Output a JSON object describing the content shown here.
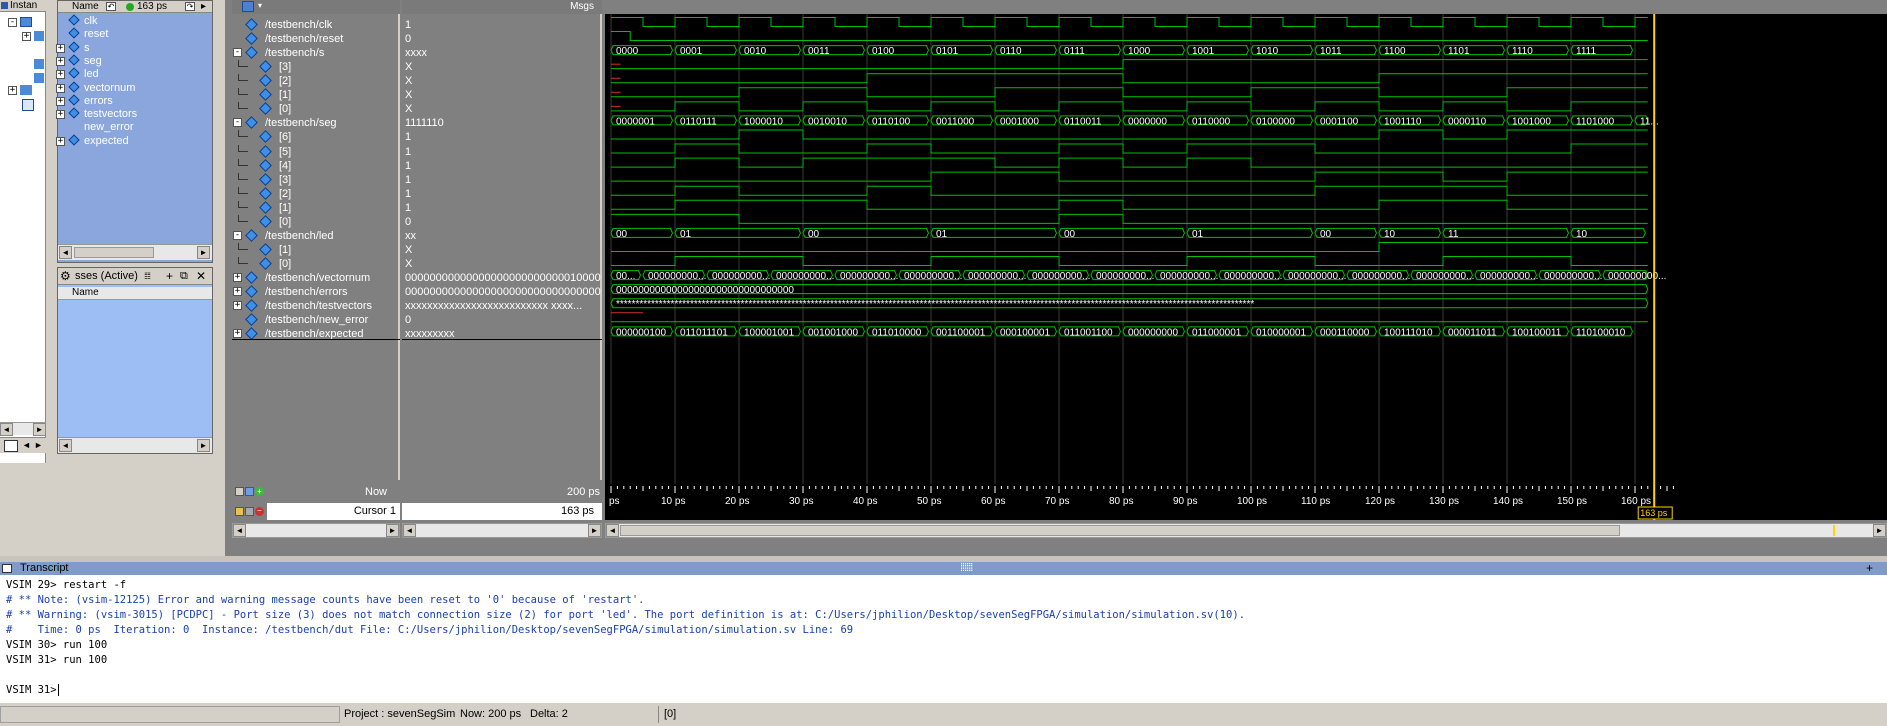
{
  "instance_panel": {
    "title": "Instan"
  },
  "objects_panel": {
    "header_name": "Name",
    "time_field": "163 ps",
    "items": [
      {
        "label": "clk",
        "expand": false
      },
      {
        "label": "reset",
        "expand": false
      },
      {
        "label": "s",
        "expand": true
      },
      {
        "label": "seg",
        "expand": true
      },
      {
        "label": "led",
        "expand": true
      },
      {
        "label": "vectornum",
        "expand": true
      },
      {
        "label": "errors",
        "expand": true
      },
      {
        "label": "testvectors",
        "expand": true
      },
      {
        "label": "new_error",
        "expand": false
      },
      {
        "label": "expected",
        "expand": true
      }
    ]
  },
  "processes_panel": {
    "title": "sses (Active)",
    "header_name": "Name"
  },
  "wave": {
    "msgs_header": "Msgs",
    "signals": [
      {
        "name": "/testbench/clk",
        "value": "1",
        "indent": 0,
        "expand": ""
      },
      {
        "name": "/testbench/reset",
        "value": "0",
        "indent": 0,
        "expand": ""
      },
      {
        "name": "/testbench/s",
        "value": "xxxx",
        "indent": 0,
        "expand": "-"
      },
      {
        "name": "[3]",
        "value": "X",
        "indent": 1,
        "expand": ""
      },
      {
        "name": "[2]",
        "value": "X",
        "indent": 1,
        "expand": ""
      },
      {
        "name": "[1]",
        "value": "X",
        "indent": 1,
        "expand": ""
      },
      {
        "name": "[0]",
        "value": "X",
        "indent": 1,
        "expand": ""
      },
      {
        "name": "/testbench/seg",
        "value": "1111110",
        "indent": 0,
        "expand": "-"
      },
      {
        "name": "[6]",
        "value": "1",
        "indent": 1,
        "expand": ""
      },
      {
        "name": "[5]",
        "value": "1",
        "indent": 1,
        "expand": ""
      },
      {
        "name": "[4]",
        "value": "1",
        "indent": 1,
        "expand": ""
      },
      {
        "name": "[3]",
        "value": "1",
        "indent": 1,
        "expand": ""
      },
      {
        "name": "[2]",
        "value": "1",
        "indent": 1,
        "expand": ""
      },
      {
        "name": "[1]",
        "value": "1",
        "indent": 1,
        "expand": ""
      },
      {
        "name": "[0]",
        "value": "0",
        "indent": 1,
        "expand": ""
      },
      {
        "name": "/testbench/led",
        "value": "xx",
        "indent": 0,
        "expand": "-"
      },
      {
        "name": "[1]",
        "value": "X",
        "indent": 1,
        "expand": ""
      },
      {
        "name": "[0]",
        "value": "X",
        "indent": 1,
        "expand": ""
      },
      {
        "name": "/testbench/vectornum",
        "value": "00000000000000000000000000010000",
        "indent": 0,
        "expand": "+"
      },
      {
        "name": "/testbench/errors",
        "value": "00000000000000000000000000000000",
        "indent": 0,
        "expand": "+"
      },
      {
        "name": "/testbench/testvectors",
        "value": "xxxxxxxxxxxxxxxxxxxxxxxxxx xxxx...",
        "indent": 0,
        "expand": "+"
      },
      {
        "name": "/testbench/new_error",
        "value": "0",
        "indent": 0,
        "expand": ""
      },
      {
        "name": "/testbench/expected",
        "value": "xxxxxxxxx",
        "indent": 0,
        "expand": "+"
      }
    ],
    "buses": {
      "s": [
        "0000",
        "0001",
        "0010",
        "0011",
        "0100",
        "0101",
        "0110",
        "0111",
        "1000",
        "1001",
        "1010",
        "1011",
        "1100",
        "1101",
        "1110",
        "1111"
      ],
      "seg": [
        "0000001",
        "0110111",
        "1000010",
        "0010010",
        "0110100",
        "0011000",
        "0001000",
        "0110011",
        "0000000",
        "0110000",
        "0100000",
        "0001100",
        "1001110",
        "0000110",
        "1001000",
        "1101000",
        "11..."
      ],
      "led": [
        {
          "t": 0,
          "v": "00"
        },
        {
          "t": 1,
          "v": "01"
        },
        {
          "t": 3,
          "v": "00"
        },
        {
          "t": 5,
          "v": "01"
        },
        {
          "t": 7,
          "v": "00"
        },
        {
          "t": 9,
          "v": "01"
        },
        {
          "t": 11,
          "v": "00"
        },
        {
          "t": 12,
          "v": "10"
        },
        {
          "t": 13,
          "v": "11"
        },
        {
          "t": 15,
          "v": "10"
        }
      ],
      "vectornum": [
        "00...",
        "000000000...",
        "000000000...",
        "000000000...",
        "000000000...",
        "000000000...",
        "000000000...",
        "000000000...",
        "000000000...",
        "000000000...",
        "000000000...",
        "000000000...",
        "000000000...",
        "000000000...",
        "000000000...",
        "000000000...",
        "000000000..."
      ],
      "errors": "00000000000000000000000000000000",
      "testvectors": "********************************************************************************************************************************************************************",
      "expected": [
        "000000100",
        "011011101",
        "100001001",
        "001001000",
        "011010000",
        "001100001",
        "000100001",
        "011001100",
        "000000000",
        "011000001",
        "010000001",
        "000110000",
        "100111010",
        "000011011",
        "100100011",
        "110100010"
      ]
    },
    "now_label": "Now",
    "now_value": "200 ps",
    "cursor_label": "Cursor 1",
    "cursor_value": "163 ps",
    "cursor_flag": "163 ps",
    "axis_ticks": [
      "ps",
      "10 ps",
      "20 ps",
      "30 ps",
      "40 ps",
      "50 ps",
      "60 ps",
      "70 ps",
      "80 ps",
      "90 ps",
      "100 ps",
      "110 ps",
      "120 ps",
      "130 ps",
      "140 ps",
      "150 ps",
      "160 ps"
    ]
  },
  "transcript": {
    "title": "Transcript",
    "lines": [
      {
        "text": "VSIM 29> restart -f",
        "cls": "cmd"
      },
      {
        "text": "# ** Note: (vsim-12125) Error and warning message counts have been reset to '0' because of 'restart'.",
        "cls": "msg"
      },
      {
        "text": "# ** Warning: (vsim-3015) [PCDPC] - Port size (3) does not match connection size (2) for port 'led'. The port definition is at: C:/Users/jphilion/Desktop/sevenSegFPGA/simulation/simulation.sv(10).",
        "cls": "msg"
      },
      {
        "text": "#    Time: 0 ps  Iteration: 0  Instance: /testbench/dut File: C:/Users/jphilion/Desktop/sevenSegFPGA/simulation/simulation.sv Line: 69",
        "cls": "msg"
      },
      {
        "text": "VSIM 30> run 100",
        "cls": "cmd"
      },
      {
        "text": "VSIM 31> run 100",
        "cls": "cmd"
      },
      {
        "text": "",
        "cls": "cmd"
      },
      {
        "text": "VSIM 31>",
        "cls": "cmd"
      }
    ]
  },
  "status": {
    "project": "Project : sevenSegSim",
    "now": "Now: 200 ps",
    "delta": "Delta: 2",
    "extra": "[0]"
  },
  "colors": {
    "wave": "#00c000",
    "bus_text": "#ffffff",
    "cursor": "#ffd400",
    "grid": "#3a3a3a",
    "panel_blue": "#8aa6dc",
    "panel_blue_light": "#9dbdf5",
    "sig_panel": "#808080"
  }
}
